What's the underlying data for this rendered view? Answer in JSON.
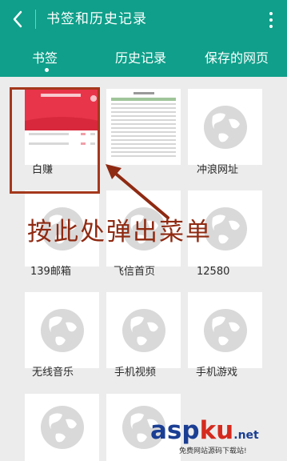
{
  "header": {
    "title": "书签和历史记录"
  },
  "tabs": [
    {
      "label": "书签",
      "active": true
    },
    {
      "label": "历史记录",
      "active": false
    },
    {
      "label": "保存的网页",
      "active": false
    }
  ],
  "bookmarks": [
    {
      "label": "白赚",
      "thumb": "red-app-screenshot"
    },
    {
      "label": "",
      "thumb": "spreadsheet-screenshot"
    },
    {
      "label": "冲浪网址",
      "thumb": "globe-placeholder"
    },
    {
      "label": "139邮箱",
      "thumb": "globe-placeholder"
    },
    {
      "label": "飞信首页",
      "thumb": "globe-placeholder"
    },
    {
      "label": "12580",
      "thumb": "globe-placeholder"
    },
    {
      "label": "无线音乐",
      "thumb": "globe-placeholder"
    },
    {
      "label": "手机视频",
      "thumb": "globe-placeholder"
    },
    {
      "label": "手机游戏",
      "thumb": "globe-placeholder"
    },
    {
      "label": "",
      "thumb": "globe-placeholder"
    },
    {
      "label": "",
      "thumb": "globe-placeholder"
    }
  ],
  "annotation": {
    "text": "按此处弹出菜单"
  },
  "watermark": {
    "asp": "asp",
    "ku": "ku",
    "net": ".net",
    "subtitle": "免费网站源码下载站!"
  },
  "colors": {
    "appbar": "#0f9f8a",
    "annotation": "#a4381c"
  },
  "icons": {
    "back": "chevron-left-icon",
    "menu": "more-vertical-icon",
    "placeholder": "globe-icon"
  }
}
